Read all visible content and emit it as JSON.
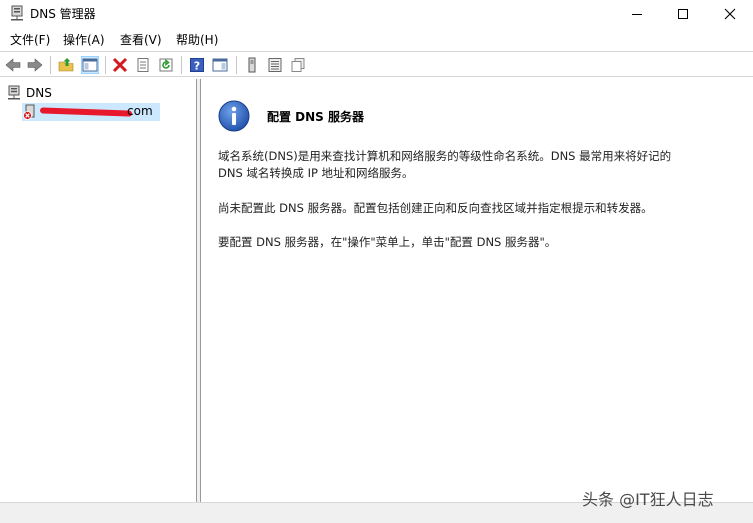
{
  "window": {
    "title": "DNS 管理器",
    "icons": {
      "app": "dns-server-icon",
      "minimize": "minimize-icon",
      "maximize": "maximize-icon",
      "close": "close-icon"
    }
  },
  "menu": {
    "items": [
      {
        "label": "文件(F)"
      },
      {
        "label": "操作(A)"
      },
      {
        "label": "查看(V)"
      },
      {
        "label": "帮助(H)"
      }
    ]
  },
  "toolbar": {
    "buttons": [
      "back-icon",
      "forward-icon",
      "up-folder-icon",
      "show-hide-console-tree-icon",
      "delete-icon",
      "properties-icon",
      "refresh-icon",
      "help-icon",
      "show-hide-action-pane-icon",
      "server-icon",
      "list-icon",
      "copy-icon"
    ]
  },
  "tree": {
    "root_label": "DNS",
    "child_label_suffix": "com",
    "child_icon": "server-error-icon"
  },
  "content": {
    "heading": "配置 DNS 服务器",
    "para1_line1": "域名系统(DNS)是用来查找计算机和网络服务的等级性命名系统。DNS 最常用来将好记的",
    "para1_line2": "DNS 域名转换成 IP 地址和网络服务。",
    "para2": "尚未配置此 DNS 服务器。配置包括创建正向和反向查找区域并指定根提示和转发器。",
    "para3": "要配置 DNS 服务器，在\"操作\"菜单上，单击\"配置 DNS 服务器\"。",
    "icon": "info-icon"
  },
  "watermark": "头条 @IT狂人日志",
  "colors": {
    "selection": "#cce8ff",
    "info_blue": "#1f5bb8",
    "delete_red": "#d4181f",
    "redaction": "#e8182c"
  }
}
